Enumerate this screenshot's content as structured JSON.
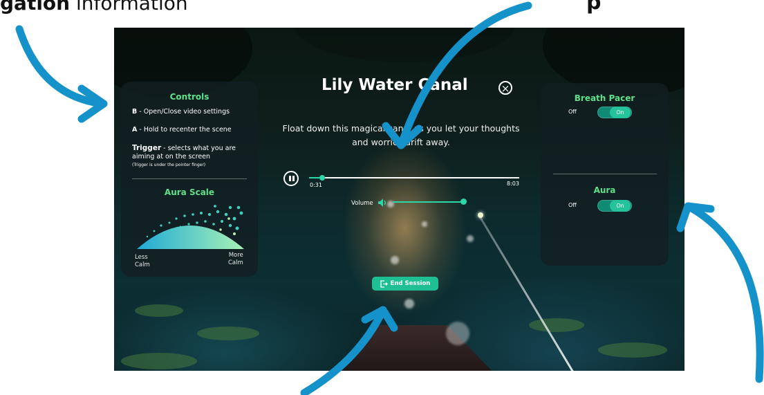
{
  "captions": {
    "top_left_bold": "gation",
    "top_left_rest": " information",
    "top_right": "p"
  },
  "video": {
    "title": "Lily Water Canal",
    "description": "Float down this magical canal as you let your thoughts and worries drift away.",
    "elapsed": "0:31",
    "duration": "8:03",
    "progress_fraction": 0.064,
    "volume_label": "Volume",
    "volume_fraction": 1.0,
    "end_session_label": "End Session"
  },
  "controls_panel": {
    "title": "Controls",
    "lines": [
      {
        "key": "B",
        "text": " - Open/Close video settings"
      },
      {
        "key": "A",
        "text": " - Hold to recenter the scene"
      },
      {
        "key": "Trigger",
        "text": " - selects what you are"
      }
    ],
    "trigger_line2": "aiming at on the screen",
    "trigger_note": "(Trigger is under the pointer finger)",
    "aura_scale_title": "Aura Scale",
    "less_calm": "Less\nCalm",
    "more_calm": "More\nCalm"
  },
  "settings_panel": {
    "breath_pacer_title": "Breath Pacer",
    "breath_pacer_off": "Off",
    "breath_pacer_on": "On",
    "aura_title": "Aura",
    "aura_off": "Off",
    "aura_on": "On"
  },
  "colors": {
    "accent_green": "#5ee08a",
    "toggle_teal": "#24c39b",
    "annotation_arrow": "#1592c9"
  },
  "icons": [
    "close-icon",
    "pause-icon",
    "volume-icon",
    "exit-icon",
    "annotation-arrow-icon"
  ]
}
